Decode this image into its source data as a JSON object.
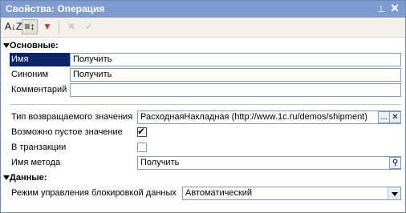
{
  "window": {
    "title": "Свойства: Операция"
  },
  "toolbar": {
    "sort_alpha_label": "A↓Z",
    "sort_category_label": "≡↕",
    "filter_label": "▼",
    "clear_label": "✕",
    "apply_label": "✓"
  },
  "groups": {
    "basic": {
      "title": "Основные:"
    },
    "data": {
      "title": "Данные:"
    }
  },
  "fields": {
    "name": {
      "label": "Имя",
      "value": "Получить"
    },
    "synonym": {
      "label": "Синоним",
      "value": "Получить"
    },
    "comment": {
      "label": "Комментарий",
      "value": ""
    },
    "return_type": {
      "label": "Тип возвращаемого значения",
      "value": "РасходнаяНакладная (http://www.1c.ru/demos/shipment)"
    },
    "nullable": {
      "label": "Возможно пустое значение",
      "checked": true
    },
    "transaction": {
      "label": "В транзакции",
      "checked": false
    },
    "method_name": {
      "label": "Имя метода",
      "value": "Получить"
    },
    "lock_mode": {
      "label": "Режим управления блокировкой данных",
      "value": "Автоматический"
    }
  }
}
